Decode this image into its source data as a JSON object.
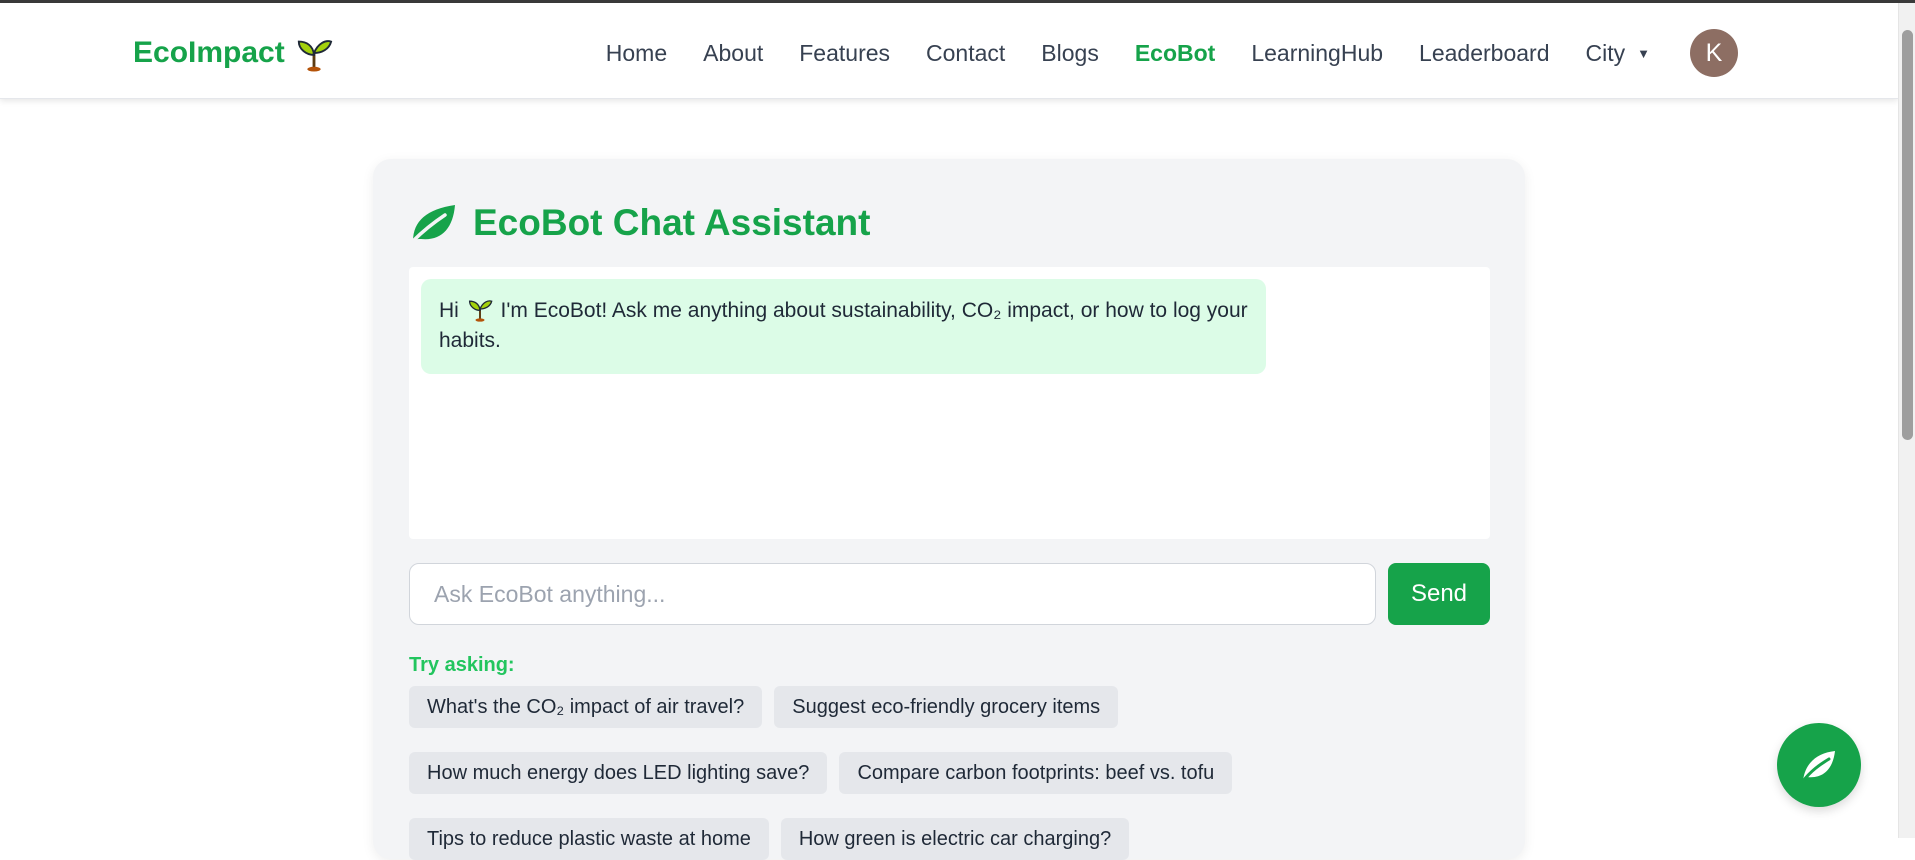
{
  "brand": {
    "name": "EcoImpact",
    "icon": "sprout-icon"
  },
  "nav": {
    "links": [
      "Home",
      "About",
      "Features",
      "Contact",
      "Blogs",
      "EcoBot",
      "LearningHub",
      "Leaderboard"
    ],
    "active": "EcoBot",
    "city_label": "City",
    "avatar_initial": "K"
  },
  "chat": {
    "title": "EcoBot Chat Assistant",
    "title_icon": "leaf-icon",
    "bot_message": {
      "prefix": "Hi",
      "text": "I'm EcoBot! Ask me anything about sustainability, CO₂ impact, or how to log your habits."
    },
    "input_placeholder": "Ask EcoBot anything...",
    "input_value": "",
    "send_label": "Send",
    "try_label": "Try asking:",
    "suggestions": [
      "What's the CO₂ impact of air travel?",
      "Suggest eco-friendly grocery items",
      "How much energy does LED lighting save?",
      "Compare carbon footprints: beef vs. tofu",
      "Tips to reduce plastic waste at home",
      "How green is electric car charging?"
    ]
  },
  "fab": {
    "icon": "leaf-icon"
  },
  "colors": {
    "accent": "#16a34a",
    "accent_light": "#22c55e",
    "bubble_bg": "#dcfce7",
    "card_bg": "#f3f4f6",
    "avatar_bg": "#8d6e63"
  }
}
